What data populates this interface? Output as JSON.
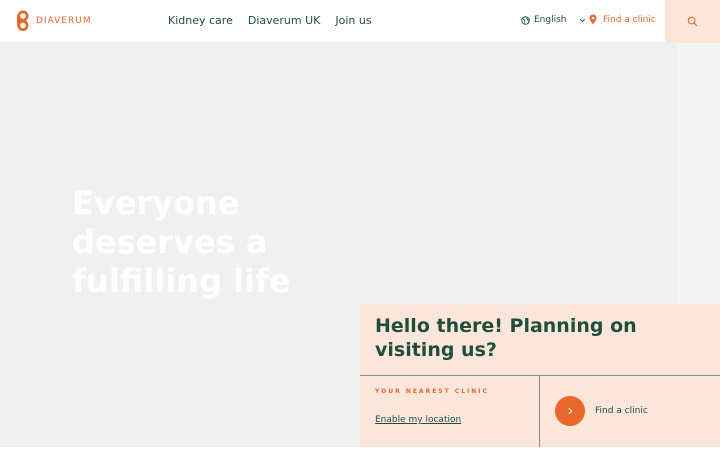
{
  "brand": {
    "name": "DIAVERUM",
    "accent": "#e8672a",
    "dark": "#1f4f3a"
  },
  "nav": {
    "items": [
      {
        "label": "Kidney care"
      },
      {
        "label": "Diaverum UK"
      },
      {
        "label": "Join us"
      }
    ]
  },
  "language": {
    "label": "English",
    "icon": "globe-icon"
  },
  "header_find": {
    "label": "Find a clinic",
    "icon": "location-pin-icon"
  },
  "search": {
    "icon": "search-icon"
  },
  "hero": {
    "title": "Everyone deserves a fulfilling life"
  },
  "panel": {
    "title": "Hello there! Planning on visiting us?",
    "nearest_label": "YOUR NEAREST CLINIC",
    "enable_location": "Enable my location",
    "find_label": "Find a clinic",
    "arrow_icon": "chevron-right-icon"
  }
}
